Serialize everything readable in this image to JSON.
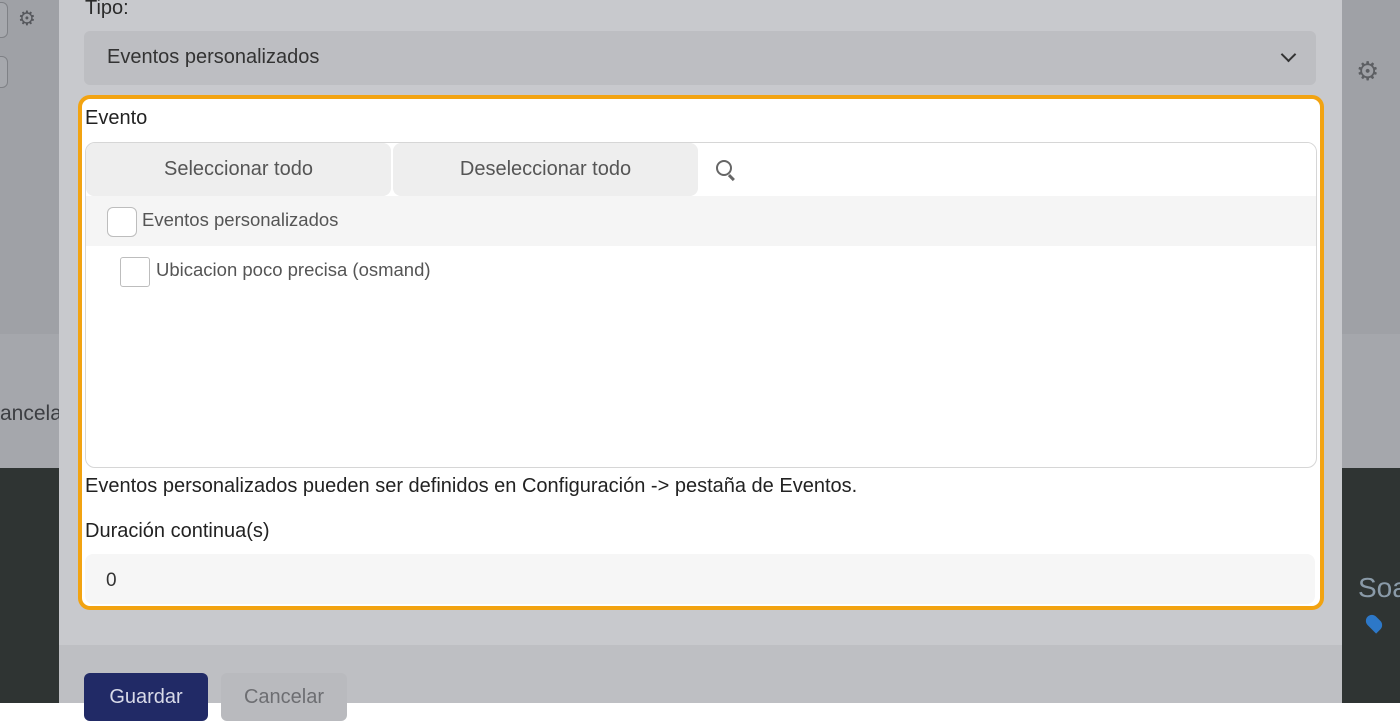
{
  "background": {
    "cancel_fragment": "ancela",
    "map_label_fragment": "Soa"
  },
  "dialog": {
    "type_label": "Tipo:",
    "type_select_value": "Eventos personalizados",
    "event_label": "Evento",
    "select_all_label": "Seleccionar todo",
    "deselect_all_label": "Deseleccionar todo",
    "search_placeholder": "",
    "tree": {
      "group_label": "Eventos personalizados",
      "group_checked": false,
      "items": [
        {
          "label": "Ubicacion poco precisa (osmand)",
          "checked": false
        }
      ]
    },
    "help_text": "Eventos personalizados pueden ser definidos en Configuración -> pestaña de Eventos.",
    "duration_label": "Duración continua(s)",
    "duration_value": "0",
    "save_label": "Guardar",
    "cancel_label": "Cancelar"
  },
  "colors": {
    "highlight_border": "#f2a311",
    "primary_button": "#212a66"
  }
}
